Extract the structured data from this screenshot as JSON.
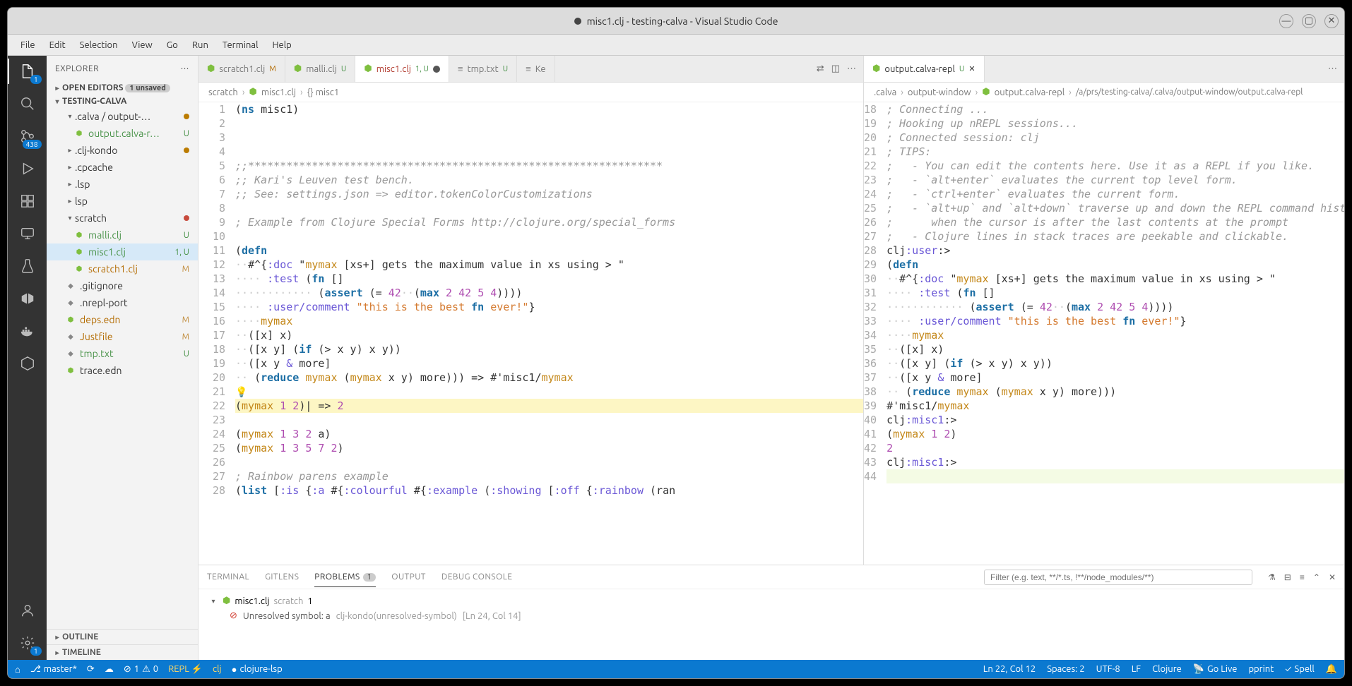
{
  "window": {
    "title": "misc1.clj - testing-calva - Visual Studio Code"
  },
  "menubar": [
    "File",
    "Edit",
    "Selection",
    "View",
    "Go",
    "Run",
    "Terminal",
    "Help"
  ],
  "activitybar": {
    "scm_badge": "438",
    "settings_badge": "1"
  },
  "sidebar": {
    "title": "EXPLORER",
    "open_editors": {
      "label": "OPEN EDITORS",
      "unsaved": "1 unsaved"
    },
    "project": "TESTING-CALVA",
    "tree": [
      {
        "indent": 1,
        "label": ".calva / output-…",
        "type": "folder-open",
        "dot": "#bb7b00"
      },
      {
        "indent": 2,
        "label": "output.calva-r…",
        "type": "clj",
        "status": "U"
      },
      {
        "indent": 1,
        "label": ".clj-kondo",
        "type": "folder",
        "dot": "#bb7b00"
      },
      {
        "indent": 1,
        "label": ".cpcache",
        "type": "folder"
      },
      {
        "indent": 1,
        "label": ".lsp",
        "type": "folder"
      },
      {
        "indent": 1,
        "label": "lsp",
        "type": "folder"
      },
      {
        "indent": 1,
        "label": "scratch",
        "type": "folder-open",
        "dot": "#c74a3c"
      },
      {
        "indent": 2,
        "label": "malli.clj",
        "type": "clj",
        "status": "U"
      },
      {
        "indent": 2,
        "label": "misc1.clj",
        "type": "clj",
        "status": "1, U",
        "active": true
      },
      {
        "indent": 2,
        "label": "scratch1.clj",
        "type": "clj",
        "status": "M"
      },
      {
        "indent": 1,
        "label": ".gitignore",
        "type": "file"
      },
      {
        "indent": 1,
        "label": ".nrepl-port",
        "type": "file"
      },
      {
        "indent": 1,
        "label": "deps.edn",
        "type": "clj",
        "status": "M"
      },
      {
        "indent": 1,
        "label": "Justfile",
        "type": "file",
        "status": "M"
      },
      {
        "indent": 1,
        "label": "tmp.txt",
        "type": "file",
        "status": "U"
      },
      {
        "indent": 1,
        "label": "trace.edn",
        "type": "clj"
      }
    ],
    "outline": "OUTLINE",
    "timeline": "TIMELINE"
  },
  "tabs_left": [
    {
      "label": "scratch1.clj",
      "status": "M",
      "icon": "clj"
    },
    {
      "label": "malli.clj",
      "status": "U",
      "icon": "clj"
    },
    {
      "label": "misc1.clj",
      "status": "1, U",
      "icon": "clj",
      "active": true,
      "dirty": true
    },
    {
      "label": "tmp.txt",
      "status": "U",
      "icon": "txt"
    },
    {
      "label": "Ke",
      "icon": "txt",
      "truncated": true
    }
  ],
  "tabs_right": [
    {
      "label": "output.calva-repl",
      "status": "U",
      "icon": "clj",
      "active": true
    }
  ],
  "breadcrumbs_left": [
    "scratch",
    "misc1.clj",
    "{} misc1"
  ],
  "breadcrumbs_right": [
    ".calva",
    "output-window",
    "output.calva-repl",
    "/a/prs/testing-calva/.calva/output-window/output.calva-repl"
  ],
  "editor_left": {
    "start": 1,
    "lines": [
      "(ns misc1)",
      "",
      "",
      "",
      ";;*****************************************************************",
      ";; Kari's Leuven test bench.",
      ";; See: settings.json => editor.tokenColorCustomizations",
      "",
      "; Example from Clojure Special Forms http://clojure.org/special_forms",
      "",
      "(defn",
      "  #^{:doc \"mymax [xs+] gets the maximum value in xs using > \"",
      "     :test (fn []",
      "             (assert (= 42  (max 2 42 5 4))))",
      "     :user/comment \"this is the best fn ever!\"}",
      "    mymax",
      "  ([x] x)",
      "  ([x y] (if (> x y) x y))",
      "  ([x y & more]",
      "   (reduce mymax (mymax x y) more))) => #'misc1/mymax",
      "💡",
      "(mymax 1 2)| => 2",
      "",
      "(mymax 1 3 2 a)",
      "(mymax 1 3 5 7 2)",
      "",
      "; Rainbow parens example",
      "(list [:is {:a #{:colourful #{:example (:showing [:off {:rainbow (ran"
    ]
  },
  "editor_right": {
    "start": 18,
    "lines": [
      "; Connecting ...",
      "; Hooking up nREPL sessions...",
      "; Connected session: clj",
      "; TIPS:",
      ";   - You can edit the contents here. Use it as a REPL if you like.",
      ";   - `alt+enter` evaluates the current top level form.",
      ";   - `ctrl+enter` evaluates the current form.",
      ";   - `alt+up` and `alt+down` traverse up and down the REPL command history",
      ";      when the cursor is after the last contents at the prompt",
      ";   - Clojure lines in stack traces are peekable and clickable.",
      "clj:user:>",
      "(defn",
      "  #^{:doc \"mymax [xs+] gets the maximum value in xs using > \"",
      "     :test (fn []",
      "             (assert (= 42  (max 2 42 5 4))))",
      "     :user/comment \"this is the best fn ever!\"}",
      "    mymax",
      "  ([x] x)",
      "  ([x y] (if (> x y) x y))",
      "  ([x y & more]",
      "   (reduce mymax (mymax x y) more)))",
      "#'misc1/mymax",
      "clj:misc1:>",
      "(mymax 1 2)",
      "2",
      "clj:misc1:>",
      ""
    ]
  },
  "panel": {
    "tabs": [
      "TERMINAL",
      "GITLENS",
      "PROBLEMS",
      "OUTPUT",
      "DEBUG CONSOLE"
    ],
    "active_tab": 2,
    "problems_count": "1",
    "filter_placeholder": "Filter (e.g. text, **/*.ts, !**/node_modules/**)",
    "problem_file": "misc1.clj",
    "problem_scope": "scratch",
    "problem_badge": "1",
    "problem_msg": "Unresolved symbol: a",
    "problem_source": "clj-kondo(unresolved-symbol)",
    "problem_loc": "[Ln 24, Col 14]"
  },
  "statusbar": {
    "branch": "master*",
    "errors": "1",
    "warnings": "0",
    "repl": "REPL ⚡",
    "lang_session": "clj",
    "clojure_lsp": "clojure-lsp",
    "position": "Ln 22, Col 12",
    "spaces": "Spaces: 2",
    "encoding": "UTF-8",
    "eol": "LF",
    "language": "Clojure",
    "golive": "Go Live",
    "pprint": "pprint",
    "spell": "Spell",
    "bell": "🔔"
  }
}
